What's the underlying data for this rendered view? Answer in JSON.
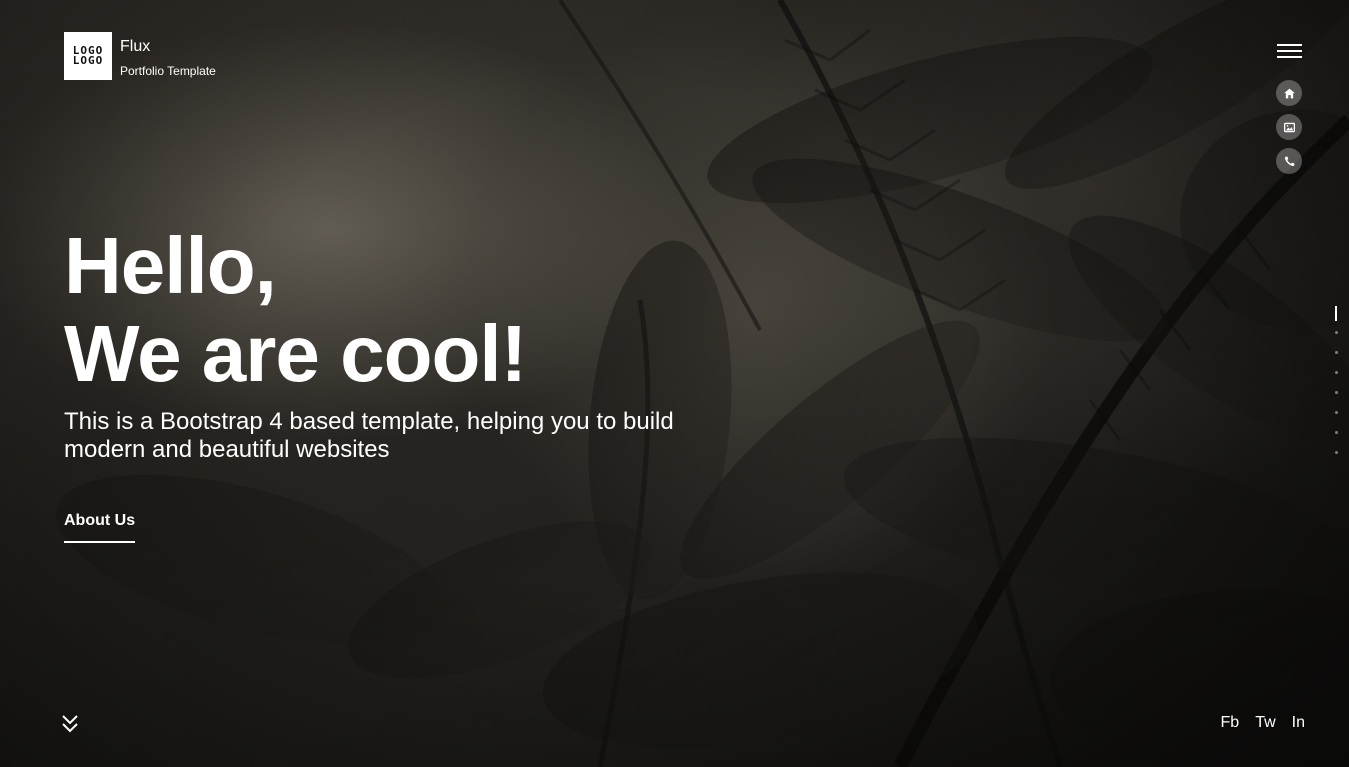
{
  "brand": {
    "logo_line1": "LOGO",
    "logo_line2": "LOGO",
    "name": "Flux",
    "tagline": "Portfolio Template"
  },
  "menu": {
    "hamburger_icon": "hamburger-menu-icon",
    "side_icons": [
      "home-icon",
      "gallery-icon",
      "phone-icon"
    ]
  },
  "section_nav": {
    "active_index": 0,
    "count": 8
  },
  "hero": {
    "headline_line1": "Hello,",
    "headline_line2": "We are cool!",
    "subtitle": "This is a Bootstrap 4 based template, helping you to build modern and beautiful websites",
    "cta_label": "About Us"
  },
  "footer": {
    "scroll_icon": "double-chevron-down-icon",
    "social": {
      "fb": "Fb",
      "tw": "Tw",
      "in": "In"
    }
  },
  "colors": {
    "text": "#ffffff",
    "icon_bg": "rgba(255,255,255,0.28)",
    "background": "#2b2824"
  }
}
